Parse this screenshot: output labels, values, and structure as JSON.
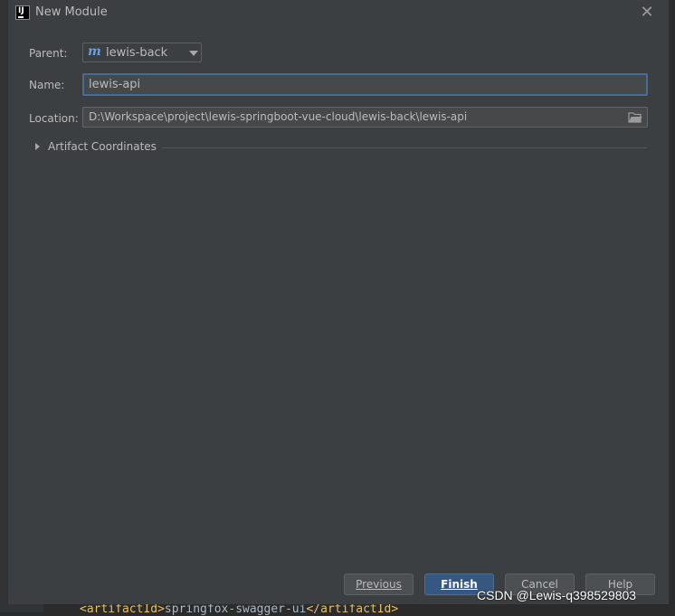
{
  "background": {
    "code_tag_open": "<artifactId>",
    "code_text": "springfox-swagger-ui",
    "code_tag_close": "</artifactId>"
  },
  "dialog": {
    "title": "New Module",
    "close_icon": "close-icon"
  },
  "form": {
    "parent": {
      "label": "Parent:",
      "value": "lewis-back",
      "icon": "maven-module-icon"
    },
    "name": {
      "label": "Name:",
      "value": "lewis-api"
    },
    "location": {
      "label": "Location:",
      "value": "D:\\Workspace\\project\\lewis-springboot-vue-cloud\\lewis-back\\lewis-api",
      "icon": "folder-icon"
    },
    "artifact_section": {
      "label": "Artifact Coordinates",
      "expanded": false
    }
  },
  "buttons": {
    "previous": "Previous",
    "finish": "Finish",
    "cancel": "Cancel",
    "help": "Help"
  },
  "watermark": "CSDN @Lewis-q398529803",
  "colors": {
    "dialog_bg": "#3c3f41",
    "accent": "#365880",
    "focus_border": "#466d94",
    "text": "#bbbbbb"
  }
}
